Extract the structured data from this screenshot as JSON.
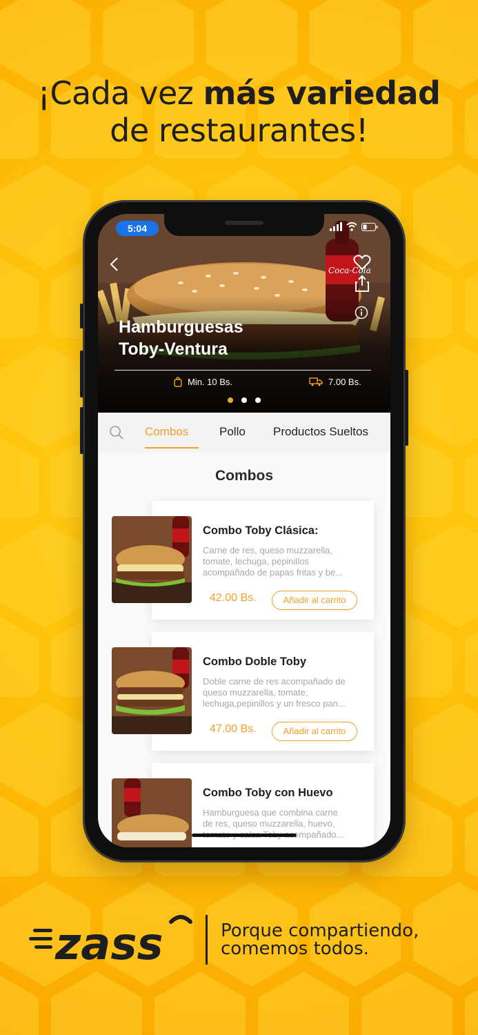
{
  "headline": {
    "line1_regular": "¡Cada vez ",
    "line1_bold": "más variedad",
    "line2": "de restaurantes!"
  },
  "status_bar": {
    "time": "5:04"
  },
  "hero": {
    "restaurant_name_line1": "Hamburguesas",
    "restaurant_name_line2": "Toby-Ventura",
    "min_order": "Min. 10 Bs.",
    "delivery_fee": "7.00 Bs.",
    "carousel_pages": 3,
    "carousel_active_index": 0
  },
  "tabs": [
    {
      "label": "Combos",
      "active": true
    },
    {
      "label": "Pollo",
      "active": false
    },
    {
      "label": "Productos Sueltos",
      "active": false
    }
  ],
  "section_title": "Combos",
  "products": [
    {
      "name": "Combo Toby Clásica:",
      "description_lines": [
        "Carne de res, queso muzzarella,",
        "tomate, lechuga, pepinillos",
        "acompañado de papas fritas y be..."
      ],
      "price": "42.00 Bs.",
      "button_label": "Añadir al carrito"
    },
    {
      "name": "Combo Doble Toby",
      "description_lines": [
        "Doble carne de res acompañado de",
        "queso muzzarella, tomate,",
        "lechuga,pepinillos y un fresco pan..."
      ],
      "price": "47.00 Bs.",
      "button_label": "Añadir al carrito"
    },
    {
      "name": "Combo Toby con Huevo",
      "description_lines": [
        "Hamburguesa que combina carne",
        "de res, queso muzzarella, huevo,",
        "tomate y salsa Toby acompañado..."
      ],
      "price": "",
      "button_label": ""
    }
  ],
  "brand": {
    "logo_text": "zass",
    "tagline_line1": "Porque compartiendo,",
    "tagline_line2": "comemos todos."
  },
  "colors": {
    "background": "#ffc20a",
    "accent": "#f0a024",
    "status_time_pill": "#1a73e8",
    "dark_text": "#1f1f1f"
  },
  "icons": [
    "back-icon",
    "heart-icon",
    "share-icon",
    "info-icon",
    "bag-icon",
    "delivery-truck-icon",
    "search-icon",
    "signal-icon",
    "wifi-icon",
    "battery-icon"
  ]
}
